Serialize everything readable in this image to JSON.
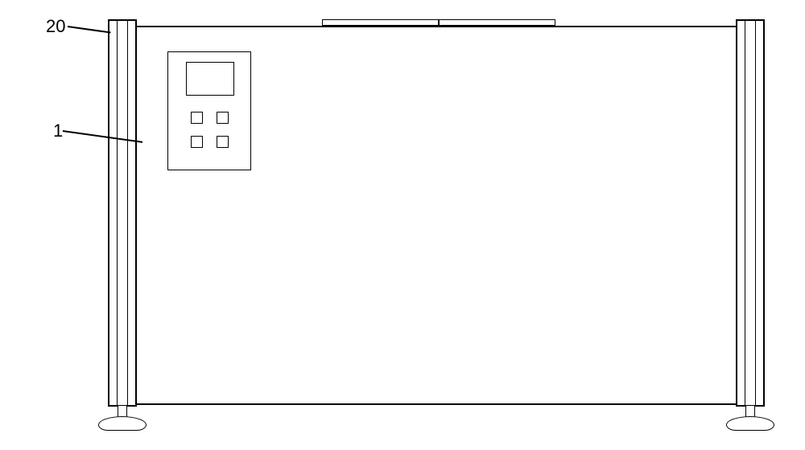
{
  "labels": {
    "post": "20",
    "body": "1"
  },
  "diagram": {
    "type": "engineering-drawing",
    "description": "Front elevation of a cabinet/machine body with two vertical support posts, leveling feet, top rail, and front control panel",
    "callouts": [
      {
        "ref": "20",
        "target": "left-post"
      },
      {
        "ref": "1",
        "target": "main-body"
      }
    ],
    "control_panel": {
      "screen_count": 1,
      "button_count": 4
    }
  }
}
